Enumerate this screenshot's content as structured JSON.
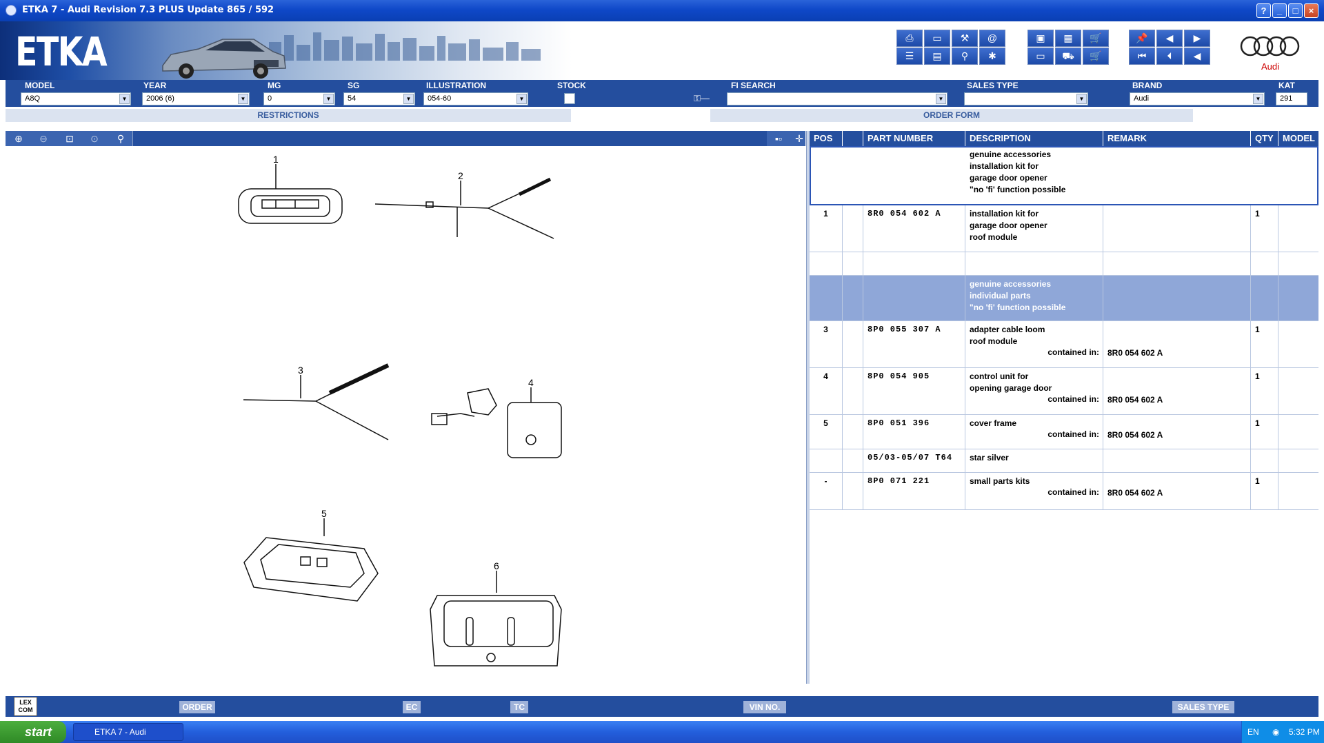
{
  "window": {
    "title": "ETKA 7 - Audi Revision 7.3 PLUS Update 865 / 592"
  },
  "banner": {
    "logo_text": "ETKA",
    "brand_text": "Audi"
  },
  "filters": {
    "model": {
      "label": "MODEL",
      "value": "A8Q"
    },
    "year": {
      "label": "YEAR",
      "value": "2006 (6)"
    },
    "mg": {
      "label": "MG",
      "value": "0"
    },
    "sg": {
      "label": "SG",
      "value": "54"
    },
    "illustration": {
      "label": "ILLUSTRATION",
      "value": "054-60"
    },
    "stock": {
      "label": "STOCK"
    },
    "fi_search": {
      "label": "FI SEARCH",
      "value": ""
    },
    "sales_type": {
      "label": "SALES TYPE",
      "value": ""
    },
    "brand": {
      "label": "BRAND",
      "value": "Audi"
    },
    "kat": {
      "label": "KAT",
      "value": "291"
    }
  },
  "sections": {
    "restrictions": "RESTRICTIONS",
    "order_form": "ORDER FORM"
  },
  "drawing": {
    "callouts": [
      "1",
      "2",
      "3",
      "4",
      "5",
      "6"
    ]
  },
  "table": {
    "headers": {
      "pos": "POS",
      "part_number": "PART NUMBER",
      "description": "DESCRIPTION",
      "remark": "REMARK",
      "qty": "QTY",
      "model": "MODEL"
    },
    "header_note": "genuine accessories\ninstallation kit for\ngarage door opener\n\"no 'fi' function possible",
    "rows": [
      {
        "pos": "1",
        "part": "8R0 054 602 A",
        "desc": "installation kit for\ngarage door opener\nroof module",
        "contained": "",
        "remark": "",
        "qty": "1"
      },
      {
        "pos": "",
        "part": "",
        "desc": "",
        "contained": "",
        "remark": "",
        "qty": ""
      },
      {
        "pos": "",
        "part": "",
        "desc": "genuine accessories\nindividual parts\n\"no 'fi' function possible",
        "contained": "",
        "remark": "",
        "qty": "",
        "highlight": true
      },
      {
        "pos": "3",
        "part": "8P0 055 307 A",
        "desc": "adapter cable loom\nroof module",
        "contained": "contained in:",
        "remark": "8R0 054 602 A",
        "qty": "1"
      },
      {
        "pos": "4",
        "part": "8P0 054 905",
        "desc": "control unit for\nopening garage door",
        "contained": "contained in:",
        "remark": "8R0 054 602 A",
        "qty": "1"
      },
      {
        "pos": "5",
        "part": "8P0 051 396",
        "desc": "cover frame",
        "contained": "contained in:",
        "remark": "8R0 054 602 A",
        "qty": "1"
      },
      {
        "pos": "",
        "part": "05/03-05/07 T64",
        "desc": "star silver",
        "contained": "",
        "remark": "",
        "qty": ""
      },
      {
        "pos": "-",
        "part": "8P0 071 221",
        "desc": "small parts kits",
        "contained": "contained in:",
        "remark": "8R0 054 602 A",
        "qty": "1"
      }
    ]
  },
  "bottom": {
    "lexcom": "LEX\nCOM",
    "order": "ORDER",
    "ec": "EC",
    "tc": "TC",
    "vin": "VIN NO.",
    "sales_type": "SALES TYPE"
  },
  "taskbar": {
    "start": "start",
    "task": "ETKA 7 - Audi",
    "lang": "EN",
    "time": "5:32 PM"
  }
}
